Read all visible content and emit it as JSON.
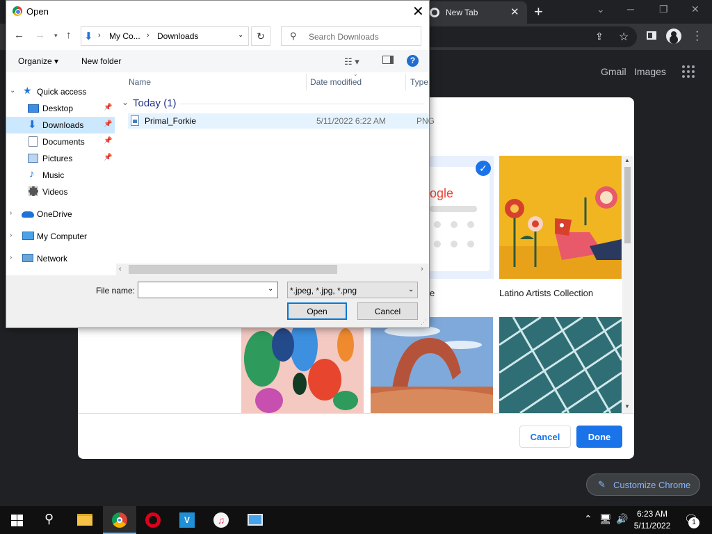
{
  "chrome": {
    "tab_title": "New Tab",
    "tab_close": "✕",
    "new_tab": "+",
    "links": {
      "gmail": "Gmail",
      "images": "Images"
    },
    "customize_button": "Customize Chrome"
  },
  "customize_dialog": {
    "tiles": [
      {
        "label": "e"
      },
      {
        "label": "Latino Artists Collection"
      }
    ],
    "cancel_label": "Cancel",
    "done_label": "Done",
    "google_partial": "ogle"
  },
  "open_dialog": {
    "title": "Open",
    "close": "✕",
    "breadcrumbs": [
      "My Co...",
      "Downloads"
    ],
    "search_placeholder": "Search Downloads",
    "organize_label": "Organize ▾",
    "new_folder_label": "New folder",
    "help": "?",
    "nav_items": [
      {
        "label": "Quick access",
        "pinned": false
      },
      {
        "label": "Desktop",
        "pinned": true
      },
      {
        "label": "Downloads",
        "pinned": true
      },
      {
        "label": "Documents",
        "pinned": true
      },
      {
        "label": "Pictures",
        "pinned": true
      },
      {
        "label": "Music",
        "pinned": false
      },
      {
        "label": "Videos",
        "pinned": false
      },
      {
        "label": "OneDrive",
        "pinned": false
      },
      {
        "label": "My Computer",
        "pinned": false
      },
      {
        "label": "Network",
        "pinned": false
      }
    ],
    "columns": {
      "name": "Name",
      "date": "Date modified",
      "type": "Type"
    },
    "group": "Today (1)",
    "files": [
      {
        "name": "Primal_Forkie",
        "date": "5/11/2022 6:22 AM",
        "type": "PNG"
      }
    ],
    "file_name_label": "File name:",
    "file_name_value": "",
    "file_type": "*.jpeg, *.jpg, *.png",
    "open_label": "Open",
    "cancel_label": "Cancel"
  },
  "taskbar": {
    "time": "6:23 AM",
    "date": "5/11/2022",
    "notifications": "1"
  },
  "colors": {
    "accent": "#1a73e8",
    "selection": "#cce8ff",
    "taskbar": "#101010"
  }
}
